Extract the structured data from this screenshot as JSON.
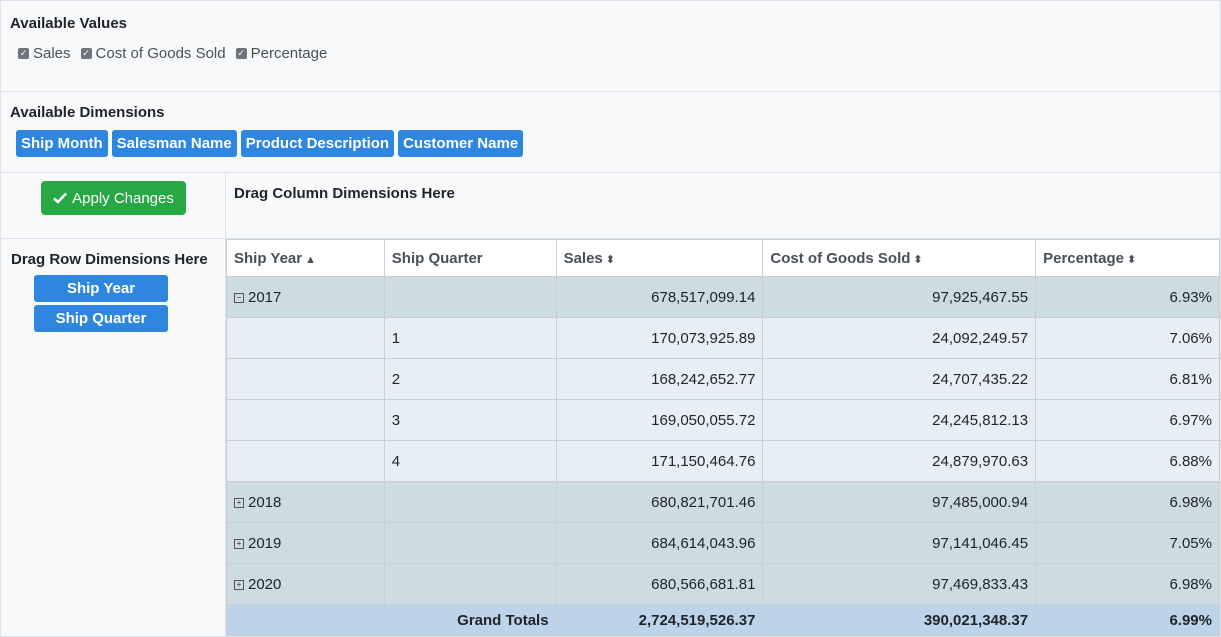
{
  "values_section": {
    "title": "Available Values",
    "items": [
      {
        "label": "Sales",
        "checked": true
      },
      {
        "label": "Cost of Goods Sold",
        "checked": true
      },
      {
        "label": "Percentage",
        "checked": true
      }
    ]
  },
  "dimensions_section": {
    "title": "Available Dimensions",
    "items": [
      "Ship Month",
      "Salesman Name",
      "Product Description",
      "Customer Name"
    ]
  },
  "apply_button": {
    "label": "Apply Changes",
    "icon": "check-icon"
  },
  "row_drop": {
    "title": "Drag Row Dimensions Here",
    "items": [
      "Ship Year",
      "Ship Quarter"
    ]
  },
  "column_drop": {
    "title": "Drag Column Dimensions Here"
  },
  "table": {
    "headers": [
      "Ship Year",
      "Ship Quarter",
      "Sales",
      "Cost of Goods Sold",
      "Percentage"
    ],
    "rows": [
      {
        "type": "year",
        "toggle": "⊟",
        "year": "2017",
        "quarter": "",
        "sales": "678,517,099.14",
        "cogs": "97,925,467.55",
        "pct": "6.93%"
      },
      {
        "type": "quarter",
        "year": "",
        "quarter": "1",
        "sales": "170,073,925.89",
        "cogs": "24,092,249.57",
        "pct": "7.06%"
      },
      {
        "type": "quarter",
        "year": "",
        "quarter": "2",
        "sales": "168,242,652.77",
        "cogs": "24,707,435.22",
        "pct": "6.81%"
      },
      {
        "type": "quarter",
        "year": "",
        "quarter": "3",
        "sales": "169,050,055.72",
        "cogs": "24,245,812.13",
        "pct": "6.97%"
      },
      {
        "type": "quarter",
        "year": "",
        "quarter": "4",
        "sales": "171,150,464.76",
        "cogs": "24,879,970.63",
        "pct": "6.88%"
      },
      {
        "type": "year",
        "toggle": "⊞",
        "year": "2018",
        "quarter": "",
        "sales": "680,821,701.46",
        "cogs": "97,485,000.94",
        "pct": "6.98%"
      },
      {
        "type": "year",
        "toggle": "⊞",
        "year": "2019",
        "quarter": "",
        "sales": "684,614,043.96",
        "cogs": "97,141,046.45",
        "pct": "7.05%"
      },
      {
        "type": "year",
        "toggle": "⊞",
        "year": "2020",
        "quarter": "",
        "sales": "680,566,681.81",
        "cogs": "97,469,833.43",
        "pct": "6.98%"
      }
    ],
    "totals": {
      "label": "Grand Totals",
      "sales": "2,724,519,526.37",
      "cogs": "390,021,348.37",
      "pct": "6.99%"
    }
  }
}
